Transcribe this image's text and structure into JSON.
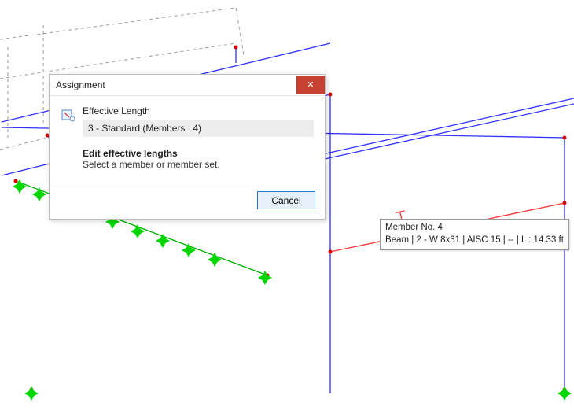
{
  "dialog": {
    "title": "Assignment",
    "section_title": "Effective Length",
    "list_item": "3 - Standard (Members : 4)",
    "instruction_bold": "Edit effective lengths",
    "instruction_sub": "Select a member or member set.",
    "cancel_label": "Cancel"
  },
  "tooltip": {
    "line1": "Member No. 4",
    "line2": "Beam | 2 - W 8x31 | AISC 15 | -- | L : 14.33 ft"
  },
  "colors": {
    "dialog_close_bg": "#c84031",
    "accent_blue": "#2a74c0",
    "beam_blue": "#3030ff",
    "beam_green": "#00b400",
    "beam_red": "#ff3b3b",
    "node_red": "#d40000",
    "support_green": "#00d600"
  }
}
